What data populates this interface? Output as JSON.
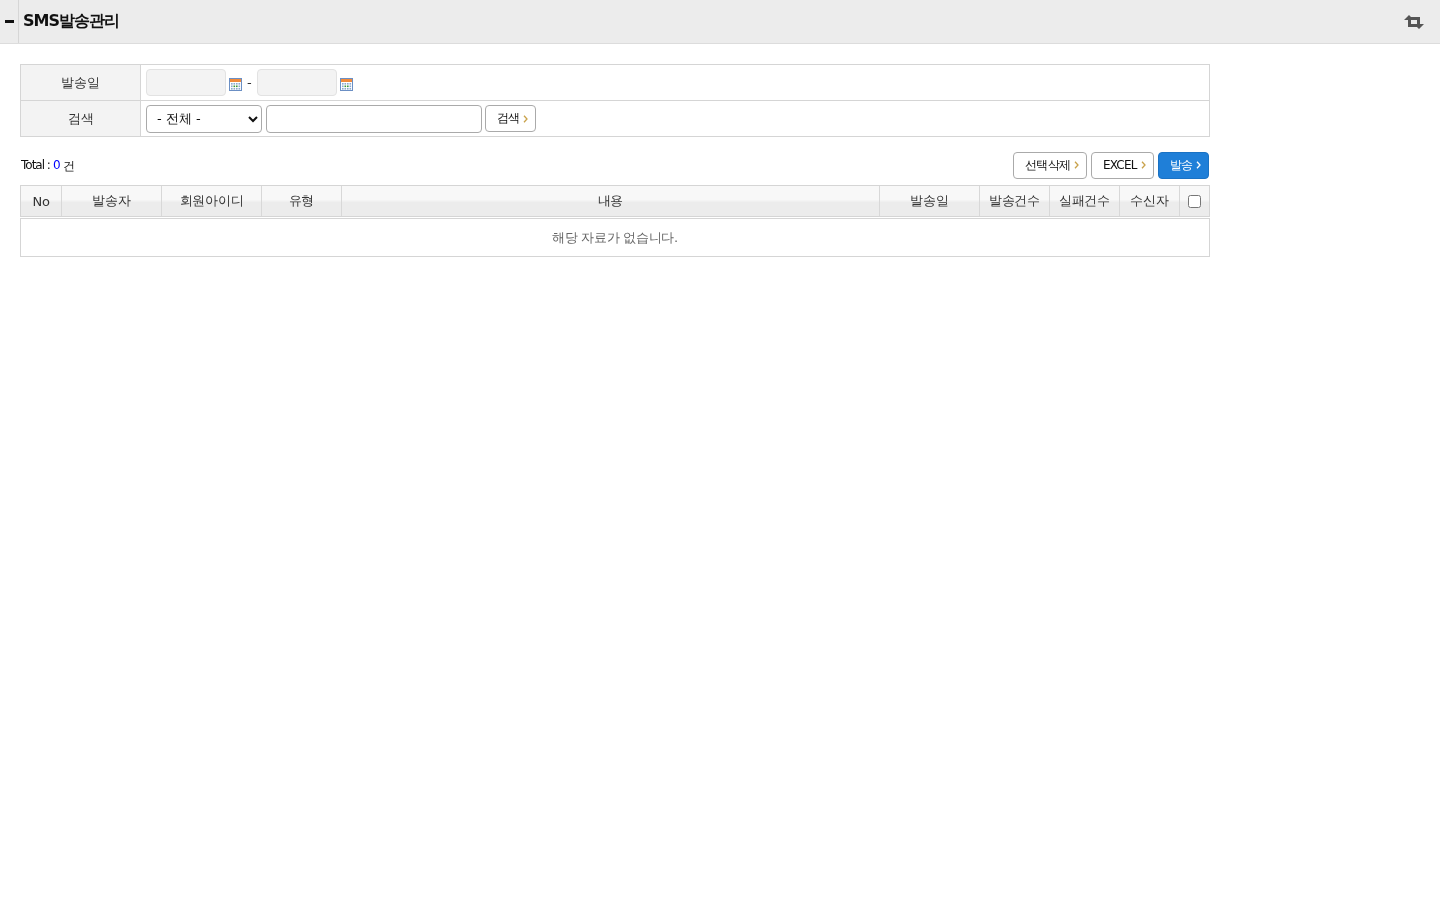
{
  "header": {
    "title": "SMS발송관리"
  },
  "filters": [
    {
      "kind": "date_range",
      "label": "발송일",
      "separator": "-"
    },
    {
      "kind": "search",
      "label": "검색",
      "select": {
        "value": "- 전체 -"
      },
      "button": "검색"
    }
  ],
  "toolbar": {
    "total_label": "Total :",
    "total_count": "0",
    "total_unit": "건",
    "buttons": [
      {
        "kind": "default",
        "label": "선택삭제"
      },
      {
        "kind": "default",
        "label": "EXCEL"
      },
      {
        "kind": "primary",
        "label": "발송"
      }
    ]
  },
  "table": {
    "columns": [
      "No",
      "발송자",
      "회원아이디",
      "유형",
      "내용",
      "발송일",
      "발송건수",
      "실패건수",
      "수신자"
    ],
    "select_all": {
      "checked": false
    },
    "empty_message": "해당 자료가 없습니다."
  }
}
